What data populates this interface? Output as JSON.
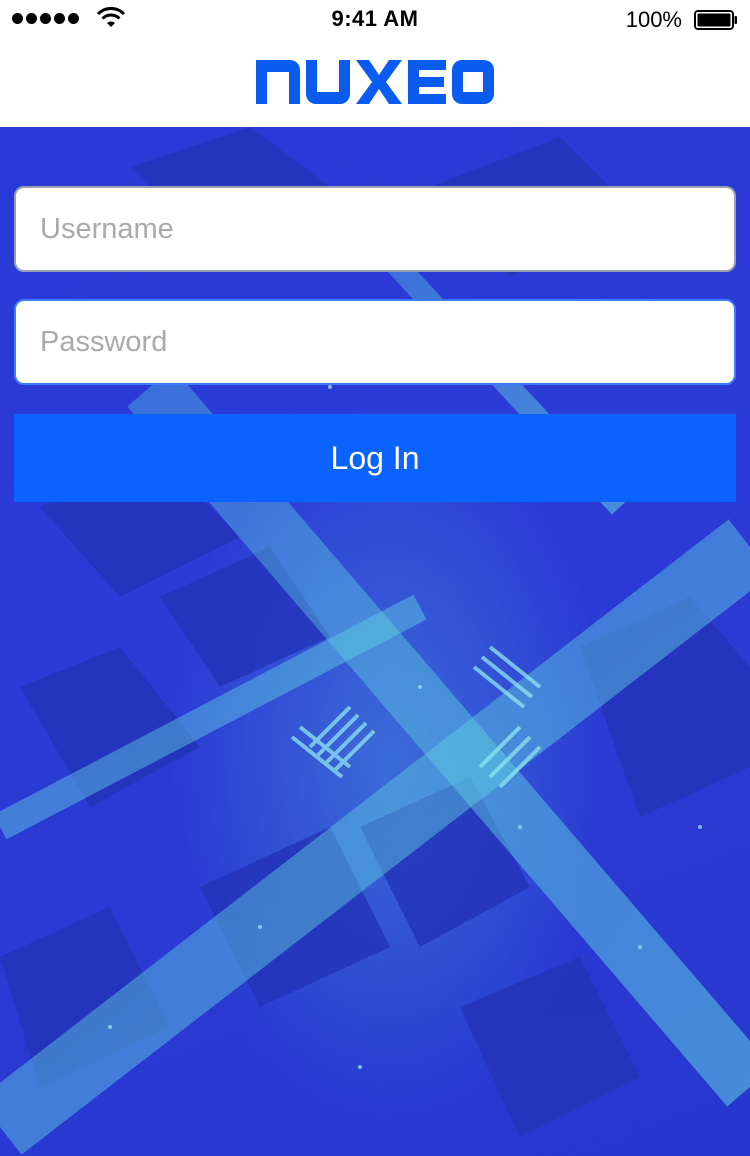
{
  "status_bar": {
    "time": "9:41 AM",
    "battery_percent": "100%",
    "icons": [
      "signal-dots-icon",
      "wifi-icon",
      "battery-icon"
    ]
  },
  "header": {
    "logo_text": "NUXEO",
    "brand_color": "#0a5cf0"
  },
  "login_form": {
    "username_placeholder": "Username",
    "username_value": "",
    "password_placeholder": "Password",
    "password_value": "",
    "login_label": "Log In"
  },
  "colors": {
    "background_blue": "#2c3bd6",
    "button_blue": "#0a62ff",
    "focus_border": "#3d7bff"
  }
}
